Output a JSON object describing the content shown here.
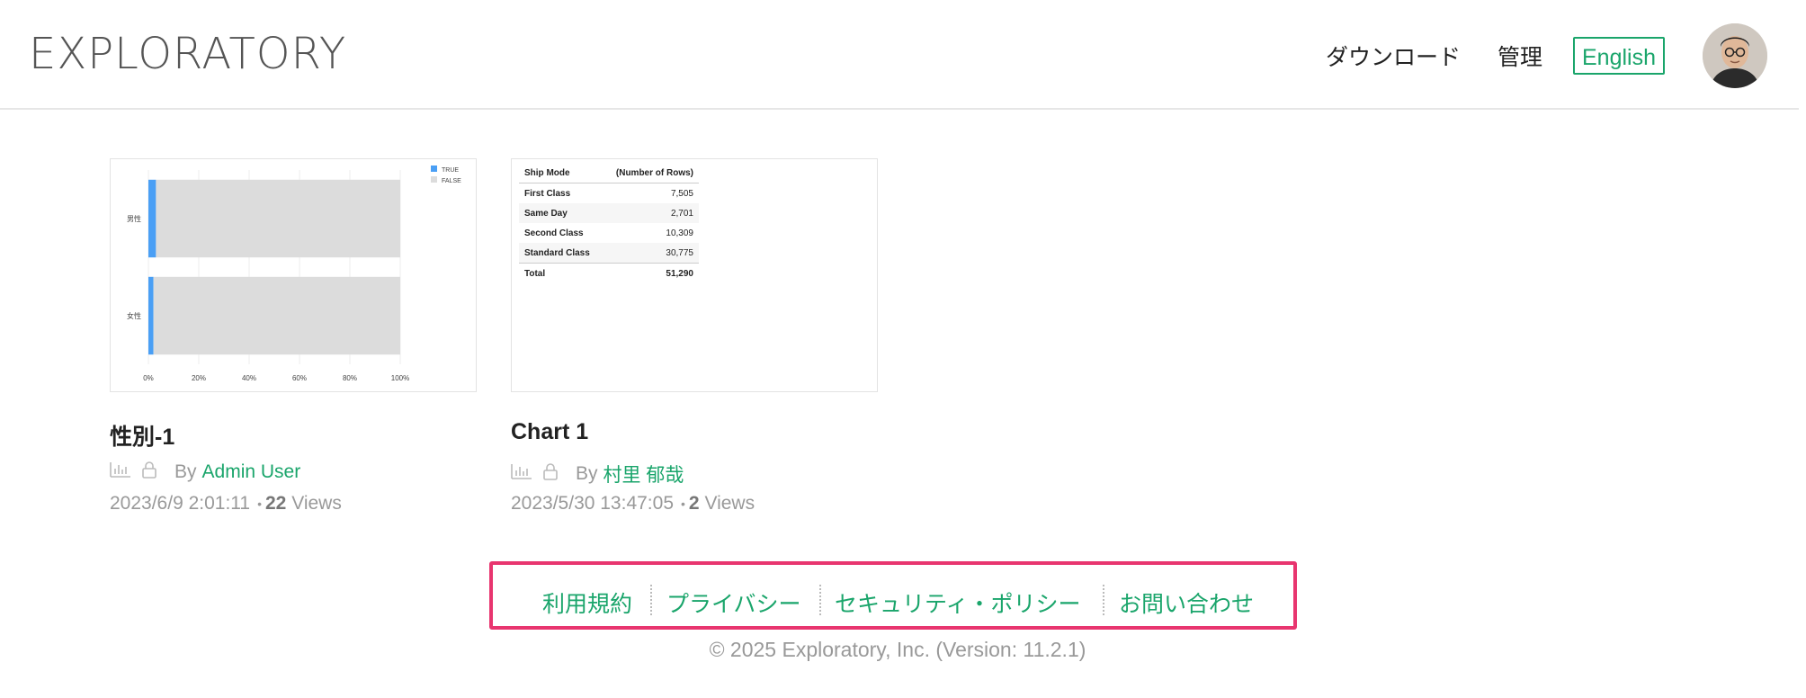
{
  "header": {
    "logo": "EXPLORATORY",
    "nav": {
      "download": "ダウンロード",
      "admin": "管理",
      "language": "English"
    }
  },
  "colors": {
    "accent": "#1aa56b",
    "highlight": "#e8356f",
    "bar_true": "#4a9ff5",
    "bar_false": "#dcdcdc"
  },
  "cards": [
    {
      "title": "性別-1",
      "by_label": "By",
      "author": "Admin User",
      "timestamp": "2023/6/9 2:01:11",
      "views_count": "22",
      "views_label": "Views",
      "icons": [
        "bar-chart-icon",
        "lock-icon"
      ],
      "chart_data": {
        "type": "bar",
        "orientation": "horizontal",
        "stacked": true,
        "categories": [
          "男性",
          "女性"
        ],
        "series": [
          {
            "name": "TRUE",
            "values": [
              3,
              2
            ]
          },
          {
            "name": "FALSE",
            "values": [
              97,
              98
            ]
          }
        ],
        "x_tick_labels": [
          "0%",
          "20%",
          "40%",
          "60%",
          "80%",
          "100%"
        ],
        "xlim": [
          0,
          100
        ],
        "legend": "top-right",
        "grid": true
      }
    },
    {
      "title": "Chart 1",
      "by_label": "By",
      "author": "村里 郁哉",
      "timestamp": "2023/5/30 13:47:05",
      "views_count": "2",
      "views_label": "Views",
      "icons": [
        "bar-chart-icon",
        "lock-icon"
      ],
      "table": {
        "headers": [
          "Ship Mode",
          "(Number of Rows)"
        ],
        "rows": [
          [
            "First Class",
            "7,505"
          ],
          [
            "Same Day",
            "2,701"
          ],
          [
            "Second Class",
            "10,309"
          ],
          [
            "Standard Class",
            "30,775"
          ]
        ],
        "total": [
          "Total",
          "51,290"
        ]
      }
    }
  ],
  "footer": {
    "links": [
      "利用規約",
      "プライバシー",
      "セキュリティ・ポリシー",
      "お問い合わせ"
    ],
    "copyright": "© 2025 Exploratory, Inc. (Version: 11.2.1)"
  }
}
